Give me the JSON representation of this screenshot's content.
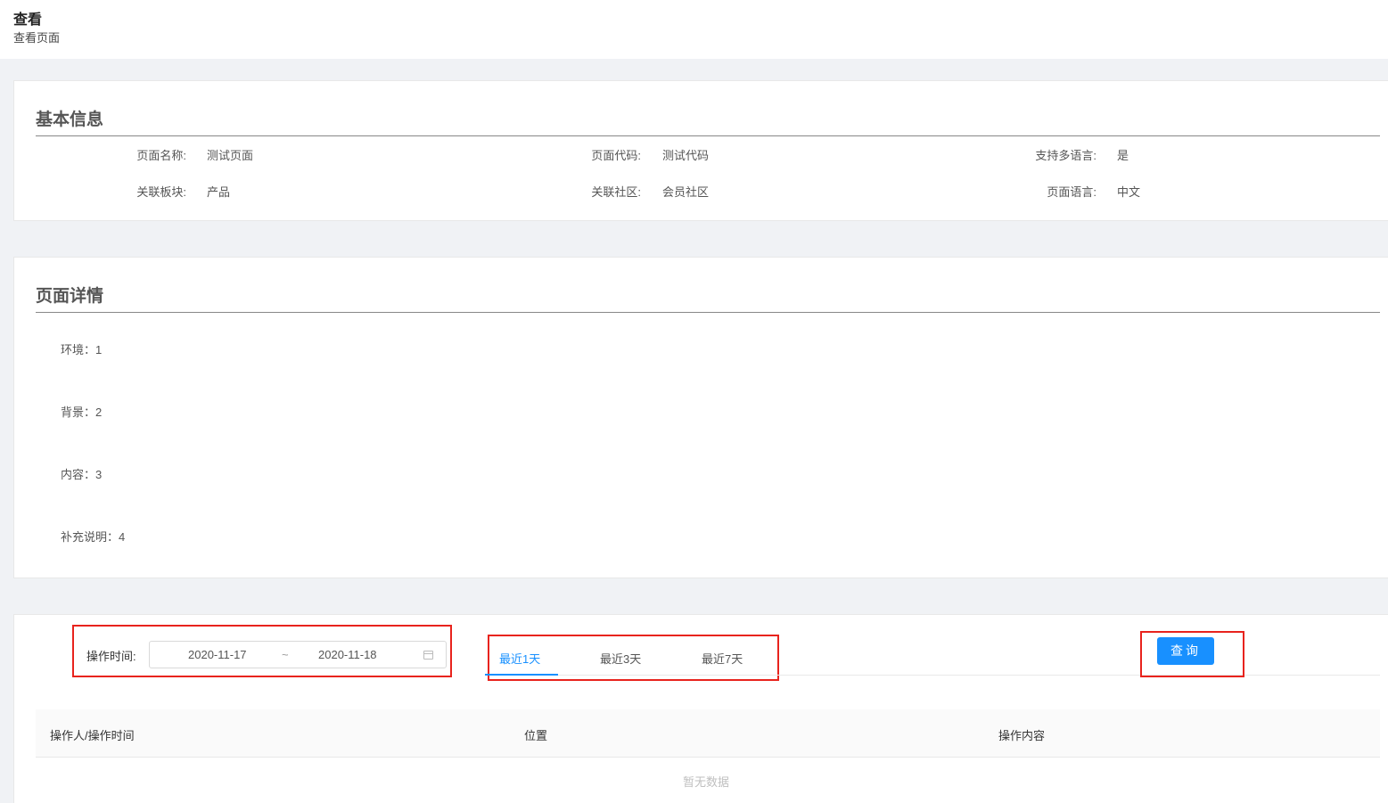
{
  "header": {
    "title": "查看",
    "subtitle": "查看页面"
  },
  "basic_info": {
    "title": "基本信息",
    "fields": [
      {
        "label": "页面名称:",
        "value": "测试页面"
      },
      {
        "label": "页面代码:",
        "value": "测试代码"
      },
      {
        "label": "支持多语言:",
        "value": "是"
      },
      {
        "label": "关联板块:",
        "value": "产品"
      },
      {
        "label": "关联社区:",
        "value": "会员社区"
      },
      {
        "label": "页面语言:",
        "value": "中文"
      }
    ]
  },
  "page_detail": {
    "title": "页面详情",
    "items": [
      "环境：1",
      "背景：2",
      "内容：3",
      "补充说明：4"
    ]
  },
  "log": {
    "filter_label": "操作时间:",
    "start_date": "2020-11-17",
    "separator": "~",
    "end_date": "2020-11-18",
    "calendar_icon": "calendar-icon",
    "tabs": [
      {
        "label": "最近1天",
        "active": true
      },
      {
        "label": "最近3天",
        "active": false
      },
      {
        "label": "最近7天",
        "active": false
      }
    ],
    "query_button": "查询",
    "columns": [
      "操作人/操作时间",
      "位置",
      "操作内容"
    ],
    "empty_text": "暂无数据"
  },
  "colors": {
    "primary": "#1890ff",
    "highlight_box": "#e8231d",
    "page_background": "#f0f2f5"
  }
}
